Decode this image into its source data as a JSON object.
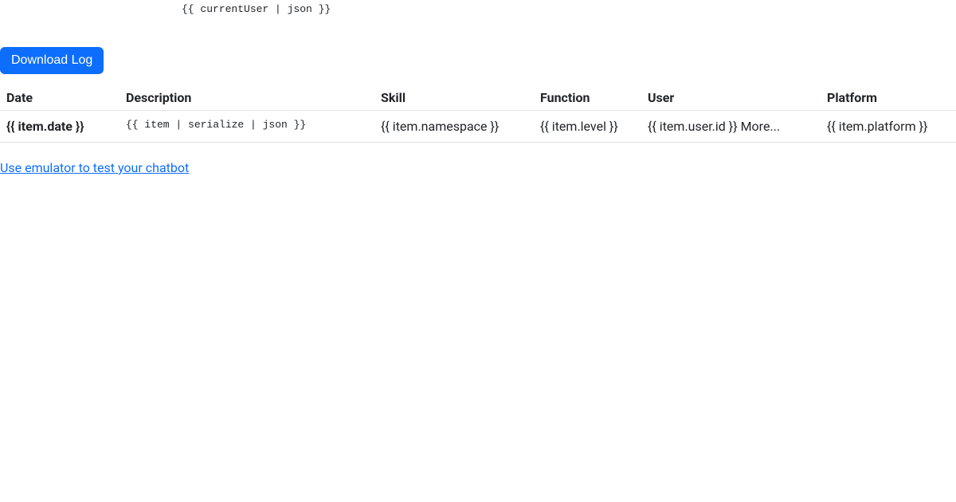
{
  "debug_expr": "{{ currentUser | json }}",
  "buttons": {
    "download_log": "Download Log"
  },
  "table": {
    "headers": {
      "date": "Date",
      "description": "Description",
      "skill": "Skill",
      "function": "Function",
      "user": "User",
      "platform": "Platform"
    },
    "rows": [
      {
        "date": "{{ item.date }}",
        "description": "{{ item | serialize | json }}",
        "skill": "{{ item.namespace }}",
        "function": "{{ item.level }}",
        "user": "{{ item.user.id }} More...",
        "platform": "{{ item.platform }}"
      }
    ]
  },
  "links": {
    "emulator": "Use emulator to test your chatbot"
  }
}
